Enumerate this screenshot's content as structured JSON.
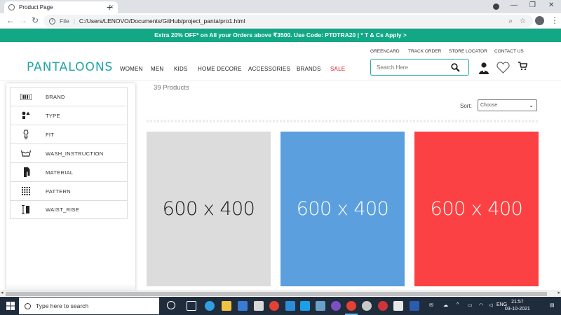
{
  "browser": {
    "tab_title": "Product Page",
    "tab_close": "×",
    "new_tab": "+",
    "url_scheme": "File",
    "url": "C:/Users/LENOVO/Documents/GitHub/project_panta/pro1.html",
    "window_controls": [
      "—",
      "❐",
      "✕"
    ]
  },
  "promo": {
    "text": "Extra 20% OFF* on All your Orders above ₹3500. Use Code: PTDTRA20 | * T & Cs Apply >"
  },
  "header": {
    "logo": "PANTALOONS",
    "util_links": [
      "GREENCARD",
      "TRACK ORDER",
      "STORE LOCATOR",
      "CONTACT US"
    ],
    "nav": [
      "WOMEN",
      "MEN",
      "KIDS",
      "HOME DECORE",
      "ACCESSORIES",
      "BRANDS",
      "SALE"
    ],
    "search_placeholder": "Search Here"
  },
  "filters": [
    {
      "label": "BRAND",
      "icon": "barcode-icon"
    },
    {
      "label": "TYPE",
      "icon": "shapes-icon"
    },
    {
      "label": "FIT",
      "icon": "dress-form-icon"
    },
    {
      "label": "WASH_INSTRUCTION",
      "icon": "wash-tub-icon"
    },
    {
      "label": "MATERIAL",
      "icon": "shirt-icon"
    },
    {
      "label": "PATTERN",
      "icon": "grid-pattern-icon"
    },
    {
      "label": "WAIST_RISE",
      "icon": "waist-rise-icon"
    }
  ],
  "products": {
    "count_text": "39 Products",
    "sort_label": "Sort:",
    "sort_selected": "Choose",
    "cards": [
      {
        "label": "600 x 400",
        "bg": "#dcdcdc",
        "fg": "#1a1a1a"
      },
      {
        "label": "600 x 400",
        "bg": "#5b9fde",
        "fg": "#ffffff"
      },
      {
        "label": "600 x 400",
        "bg": "#fb4143",
        "fg": "#ffffff"
      }
    ]
  },
  "taskbar": {
    "search_placeholder": "Type here to search",
    "lang": "ENG",
    "time": "21:57",
    "date": "03-10-2021"
  },
  "colors": {
    "accent": "#12a886",
    "logo": "#21a5a5",
    "sale": "#e21a22"
  }
}
